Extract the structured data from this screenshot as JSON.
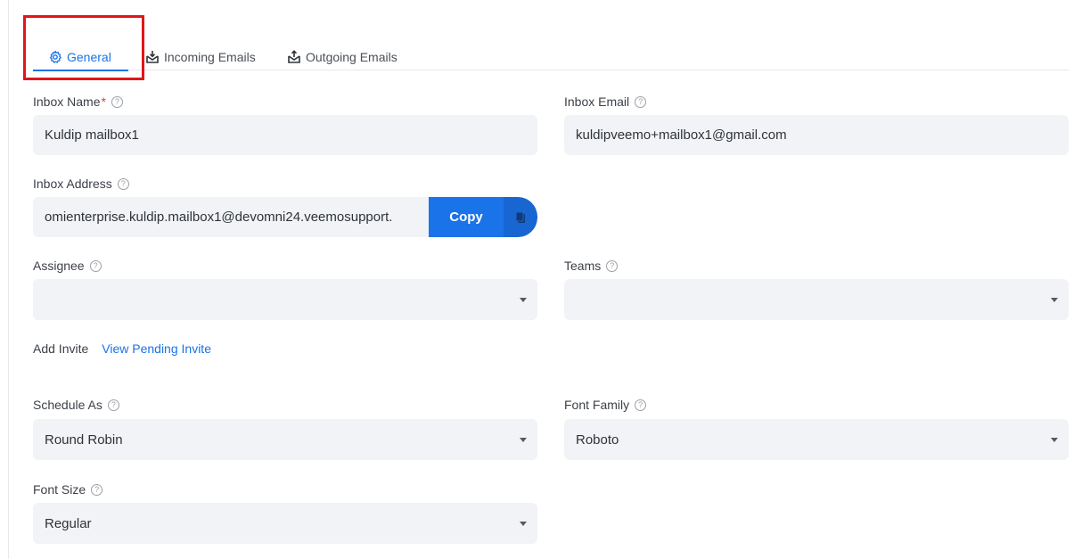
{
  "tabs": [
    {
      "label": "General",
      "icon": "gear-icon",
      "active": true
    },
    {
      "label": "Incoming Emails",
      "icon": "inbox-download-icon",
      "active": false
    },
    {
      "label": "Outgoing Emails",
      "icon": "inbox-upload-icon",
      "active": false
    }
  ],
  "form": {
    "inbox_name": {
      "label": "Inbox Name",
      "required_mark": "*",
      "value": "Kuldip mailbox1"
    },
    "inbox_email": {
      "label": "Inbox Email",
      "value": "kuldipveemo+mailbox1@gmail.com"
    },
    "inbox_address": {
      "label": "Inbox Address",
      "value": "omienterprise.kuldip.mailbox1@devomni24.veemosupport.",
      "copy_label": "Copy"
    },
    "assignee": {
      "label": "Assignee",
      "value": ""
    },
    "teams": {
      "label": "Teams",
      "value": ""
    },
    "invite": {
      "add_label": "Add Invite",
      "view_label": "View Pending Invite"
    },
    "schedule_as": {
      "label": "Schedule As",
      "value": "Round Robin"
    },
    "font_family": {
      "label": "Font Family",
      "value": "Roboto"
    },
    "font_size": {
      "label": "Font Size",
      "value": "Regular"
    }
  },
  "help_glyph": "?",
  "colors": {
    "accent": "#1a73e8",
    "field_bg": "#f1f3f6",
    "required": "#e53935",
    "highlight": "#e4141b"
  }
}
